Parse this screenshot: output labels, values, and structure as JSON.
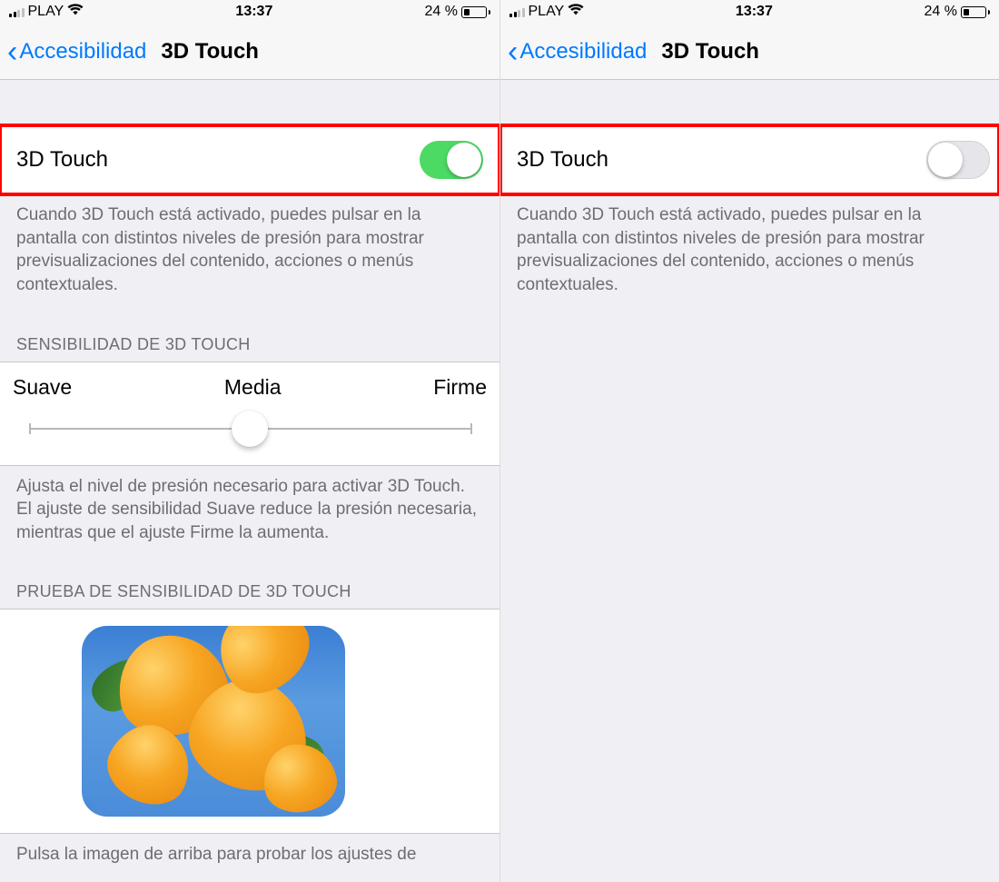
{
  "status": {
    "carrier": "PLAY",
    "time": "13:37",
    "battery_pct": "24 %",
    "battery_fill_pct": 24
  },
  "nav": {
    "back_label": "Accesibilidad",
    "title": "3D Touch"
  },
  "toggle": {
    "label": "3D Touch",
    "description": "Cuando 3D Touch está activado, puedes pulsar en la pantalla con distintos niveles de presión para mostrar previsualizaciones del contenido, acciones o menús contextuales."
  },
  "sensitivity": {
    "header": "SENSIBILIDAD DE 3D TOUCH",
    "left": "Suave",
    "center": "Media",
    "right": "Firme",
    "value_pct": 50,
    "footer": "Ajusta el nivel de presión necesario para activar 3D Touch. El ajuste de sensibilidad Suave reduce la presión necesaria, mientras que el ajuste Firme la aumenta."
  },
  "test": {
    "header": "PRUEBA DE SENSIBILIDAD DE 3D TOUCH",
    "footer_partial": "Pulsa la imagen de arriba para probar los ajustes de"
  },
  "left_screen": {
    "toggle_on": true
  },
  "right_screen": {
    "toggle_on": false
  }
}
